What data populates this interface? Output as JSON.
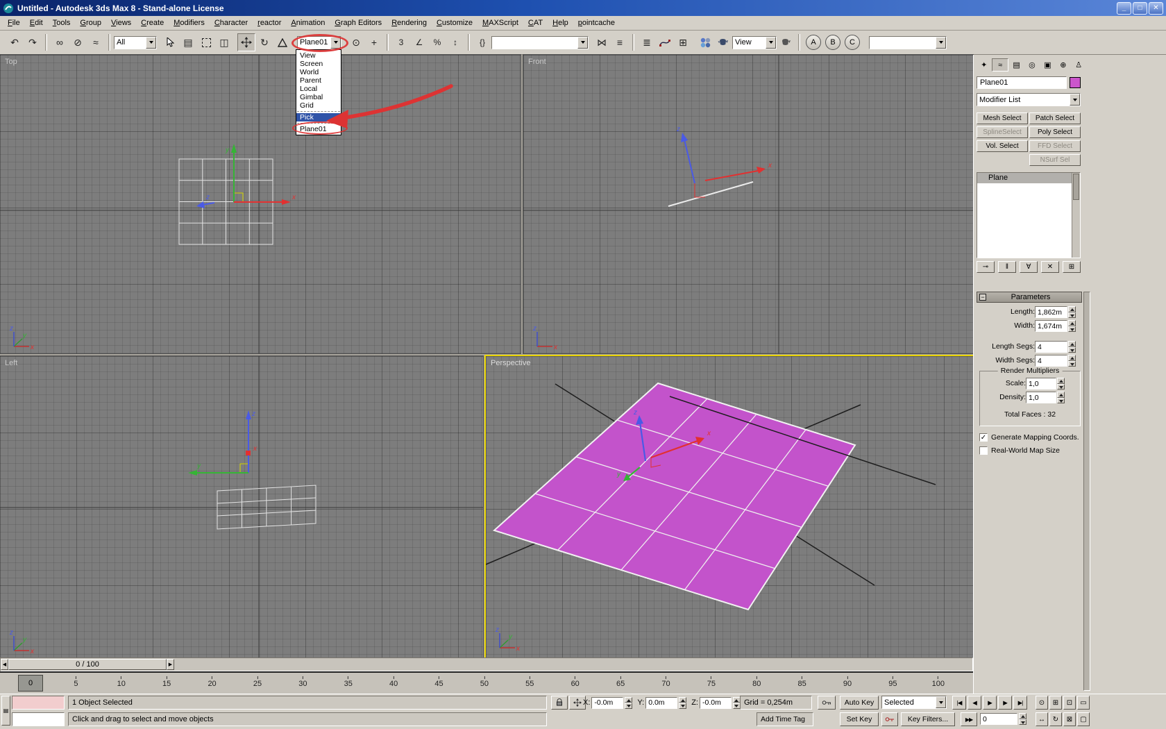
{
  "window": {
    "title": "Untitled - Autodesk 3ds Max 8  - Stand-alone License"
  },
  "menu": {
    "items": [
      "File",
      "Edit",
      "Tools",
      "Group",
      "Views",
      "Create",
      "Modifiers",
      "Character",
      "reactor",
      "Animation",
      "Graph Editors",
      "Rendering",
      "Customize",
      "MAXScript",
      "CAT",
      "Help",
      "pointcache"
    ]
  },
  "toolbar": {
    "selection_filter": "All",
    "coordinate_system": "Plane01",
    "render_type": "View",
    "abc_buttons": [
      "A",
      "B",
      "C"
    ],
    "snap_labels": [
      "3",
      "∠",
      "%",
      "↕"
    ]
  },
  "icons": {
    "undo": "↶",
    "redo": "↷",
    "link": "∞",
    "unlink": "⊘",
    "bind": "≈",
    "select_by_name": "▤",
    "window_crossing": "◫",
    "rotate": "↻",
    "pivot": "⊙",
    "manipulate": "+",
    "named_sets": "{}",
    "mirror": "⋈",
    "align": "≡",
    "layers": "≣",
    "schematic": "⊞",
    "check": "✓",
    "minus": "−",
    "min": "_",
    "max": "□",
    "close": "✕",
    "left_arrow": "◀",
    "right_arrow": "▶",
    "listener_grip": "▤",
    "playback": [
      "|◀",
      "◀",
      "▶",
      "▶",
      "▶|"
    ],
    "nav_row1": [
      "⊙",
      "⊞",
      "⊡",
      "▭"
    ],
    "nav_row2": [
      "↔",
      "↻",
      "⊠",
      "▢"
    ],
    "stack_tools": [
      "⊸",
      "‖",
      "∀",
      "✕",
      "⊞"
    ],
    "key_mode": "▶▶",
    "tabs": [
      "✦",
      "≈",
      "▤",
      "◎",
      "▣",
      "⊕",
      "♙"
    ]
  },
  "coord_dropdown": {
    "items": [
      "View",
      "Screen",
      "World",
      "Parent",
      "Local",
      "Gimbal",
      "Grid"
    ],
    "pick_item": "Pick",
    "object_item": "Plane01"
  },
  "viewports": {
    "top_label": "Top",
    "front_label": "Front",
    "left_label": "Left",
    "perspective_label": "Perspective"
  },
  "axes": {
    "x": "x",
    "y": "y",
    "z": "z"
  },
  "command_panel": {
    "object_name": "Plane01",
    "modifier_list_label": "Modifier List",
    "select_buttons": [
      "Mesh Select",
      "Patch Select",
      "SplineSelect",
      "Poly Select",
      "Vol. Select",
      "FFD Select",
      "",
      "NSurf Sel"
    ],
    "stack_items": [
      "Plane"
    ],
    "parameters": {
      "title": "Parameters",
      "size_rows": [
        {
          "label": "Length:",
          "value": "1,862m"
        },
        {
          "label": "Width:",
          "value": "1,674m"
        }
      ],
      "seg_rows": [
        {
          "label": "Length Segs:",
          "value": "4"
        },
        {
          "label": "Width Segs:",
          "value": "4"
        }
      ],
      "render_multipliers_title": "Render Multipliers",
      "mult_rows": [
        {
          "label": "Scale:",
          "value": "1,0"
        },
        {
          "label": "Density:",
          "value": "1,0"
        }
      ],
      "total_faces": "Total Faces : 32",
      "checkbox_mapping": "Generate Mapping Coords.",
      "checkbox_realworld": "Real-World Map Size"
    }
  },
  "timeline": {
    "slider_label": "0 / 100",
    "current_frame": "0",
    "ticks": [
      "0",
      "5",
      "10",
      "15",
      "20",
      "25",
      "30",
      "35",
      "40",
      "45",
      "50",
      "55",
      "60",
      "65",
      "70",
      "75",
      "80",
      "85",
      "90",
      "95",
      "100"
    ]
  },
  "status": {
    "selection": "1 Object Selected",
    "prompt": "Click and drag to select and move objects",
    "coord_fields": [
      {
        "label": "X:",
        "value": "-0.0m"
      },
      {
        "label": "Y:",
        "value": "0.0m"
      },
      {
        "label": "Z:",
        "value": "-0.0m"
      }
    ],
    "grid_size": "Grid = 0,254m",
    "add_time_tag": "Add Time Tag",
    "auto_key": "Auto Key",
    "set_key": "Set Key",
    "key_filters": "Key Filters...",
    "selected_mode": "Selected",
    "frame_field": "0"
  }
}
